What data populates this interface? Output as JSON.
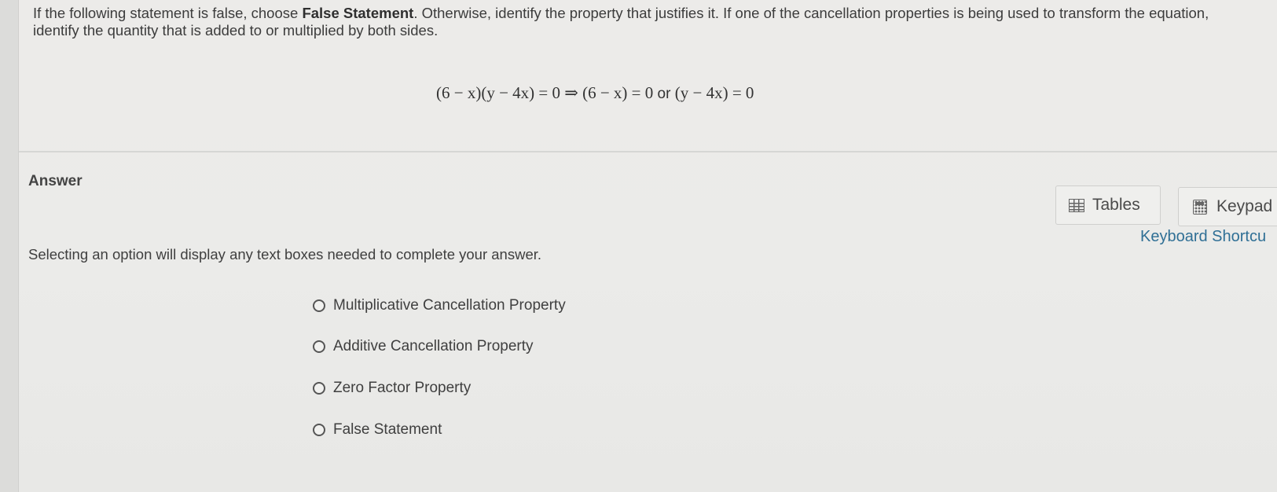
{
  "question": {
    "text_before": "If the following statement is false, choose ",
    "emphasis": "False Statement",
    "text_after": ". Otherwise, identify the property that justifies it. If one of the cancellation properties is being used to transform the equation, identify the quantity that is added to or multiplied by both sides."
  },
  "equation": {
    "part1": "(6 − x)(y − 4x) = 0 ⇒ (6 − x) = 0",
    "connector": " or ",
    "part2": "(y − 4x) = 0"
  },
  "answer": {
    "label": "Answer",
    "helper_text": "Selecting an option will display any text boxes needed to complete your answer."
  },
  "tools": {
    "tables_label": "Tables",
    "keypad_label": "Keypad",
    "shortcuts_label": "Keyboard Shortcu",
    "tables_icon": "grid-icon",
    "keypad_icon": "calculator-icon"
  },
  "options": [
    {
      "label": "Multiplicative Cancellation Property",
      "selected": false
    },
    {
      "label": "Additive Cancellation Property",
      "selected": false
    },
    {
      "label": "Zero Factor Property",
      "selected": false
    },
    {
      "label": "False Statement",
      "selected": false
    }
  ],
  "colors": {
    "link": "#2f6f95",
    "background": "#ebebe9"
  }
}
